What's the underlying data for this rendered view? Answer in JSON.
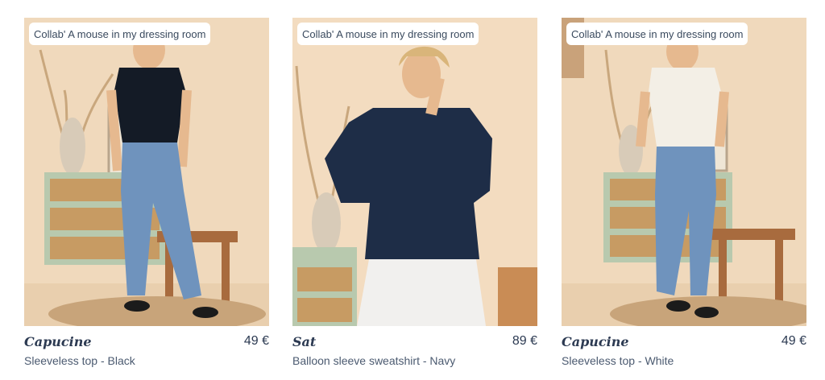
{
  "products": [
    {
      "badge": "Collab' A mouse in my dressing room",
      "brand": "Capucine",
      "price": "49 €",
      "name": "Sleeveless top - Black",
      "top_color": "#141b26",
      "bottom_color": "#6f93bd"
    },
    {
      "badge": "Collab' A mouse in my dressing room",
      "brand": "Sat",
      "price": "89 €",
      "name": "Balloon sleeve sweatshirt - Navy",
      "top_color": "#1e2d47",
      "bottom_color": "#f1f0ee"
    },
    {
      "badge": "Collab' A mouse in my dressing room",
      "brand": "Capucine",
      "price": "49 €",
      "name": "Sleeveless top - White",
      "top_color": "#f3efe6",
      "bottom_color": "#6f93bd"
    }
  ]
}
